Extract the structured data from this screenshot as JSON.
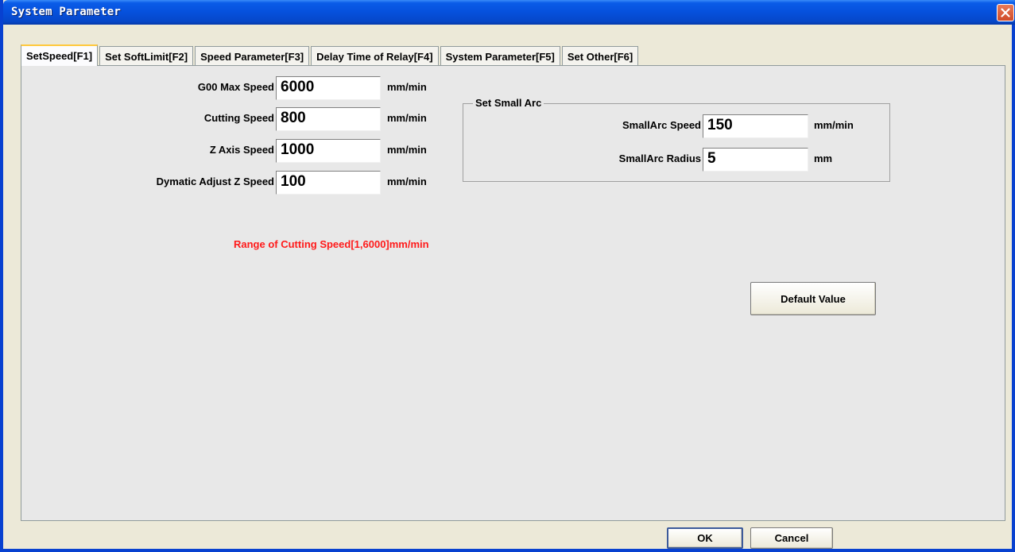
{
  "window": {
    "title": "System Parameter"
  },
  "tabs": [
    {
      "label": "SetSpeed[F1]",
      "active": true
    },
    {
      "label": "Set SoftLimit[F2]",
      "active": false
    },
    {
      "label": "Speed Parameter[F3]",
      "active": false
    },
    {
      "label": "Delay Time of Relay[F4]",
      "active": false
    },
    {
      "label": "System Parameter[F5]",
      "active": false
    },
    {
      "label": "Set Other[F6]",
      "active": false
    }
  ],
  "speed_fields": [
    {
      "label": "G00 Max Speed",
      "value": "6000",
      "unit": "mm/min"
    },
    {
      "label": "Cutting Speed",
      "value": "800",
      "unit": "mm/min"
    },
    {
      "label": "Z Axis Speed",
      "value": "1000",
      "unit": "mm/min"
    },
    {
      "label": "Dymatic Adjust Z Speed",
      "value": "100",
      "unit": "mm/min"
    }
  ],
  "small_arc": {
    "title": "Set Small Arc",
    "fields": [
      {
        "label": "SmallArc Speed",
        "value": "150",
        "unit": "mm/min"
      },
      {
        "label": "SmallArc Radius",
        "value": "5",
        "unit": "mm"
      }
    ]
  },
  "hint": {
    "text": "Range of Cutting Speed[1,6000]mm/min",
    "color": "#ff1a1a"
  },
  "buttons": {
    "default_value": "Default Value",
    "ok": "OK",
    "cancel": "Cancel"
  },
  "colors": {
    "titlebar": "#0650dc",
    "close": "#d04a28",
    "panel": "#e8e8e8"
  },
  "icons": {
    "close": "close-icon"
  }
}
